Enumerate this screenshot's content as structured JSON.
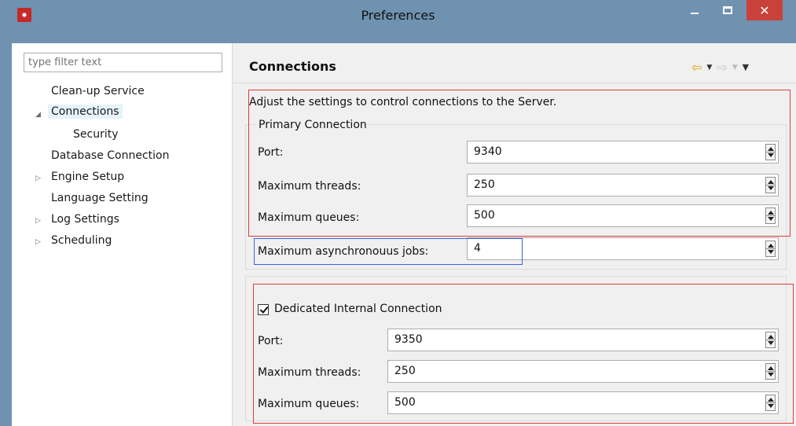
{
  "window": {
    "title": "Preferences",
    "close_glyph": "✕"
  },
  "left": {
    "filter_placeholder": "type filter text",
    "tree": [
      {
        "label": "Clean-up Service"
      },
      {
        "label": "Connections",
        "expanded": true
      },
      {
        "label": "Security"
      },
      {
        "label": "Database Connection"
      },
      {
        "label": "Engine Setup"
      },
      {
        "label": "Language Setting"
      },
      {
        "label": "Log Settings"
      },
      {
        "label": "Scheduling"
      }
    ]
  },
  "page": {
    "title": "Connections",
    "description": "Adjust the settings to control connections to the Server.",
    "primary": {
      "legend": "Primary Connection",
      "port_label": "Port:",
      "port_value": "9340",
      "threads_label": "Maximum threads:",
      "threads_value": "250",
      "queues_label": "Maximum queues:",
      "queues_value": "500"
    },
    "async": {
      "label": "Maximum asynchronouus jobs:",
      "value": "4"
    },
    "internal": {
      "checkbox_label": "Dedicated Internal Connection",
      "checked": true,
      "port_label": "Port:",
      "port_value": "9350",
      "threads_label": "Maximum threads:",
      "threads_value": "250",
      "queues_label": "Maximum queues:",
      "queues_value": "500"
    }
  },
  "colors": {
    "accent_red": "#e23b3b",
    "accent_blue": "#3b5fe2",
    "back_arrow": "#e0a000"
  }
}
